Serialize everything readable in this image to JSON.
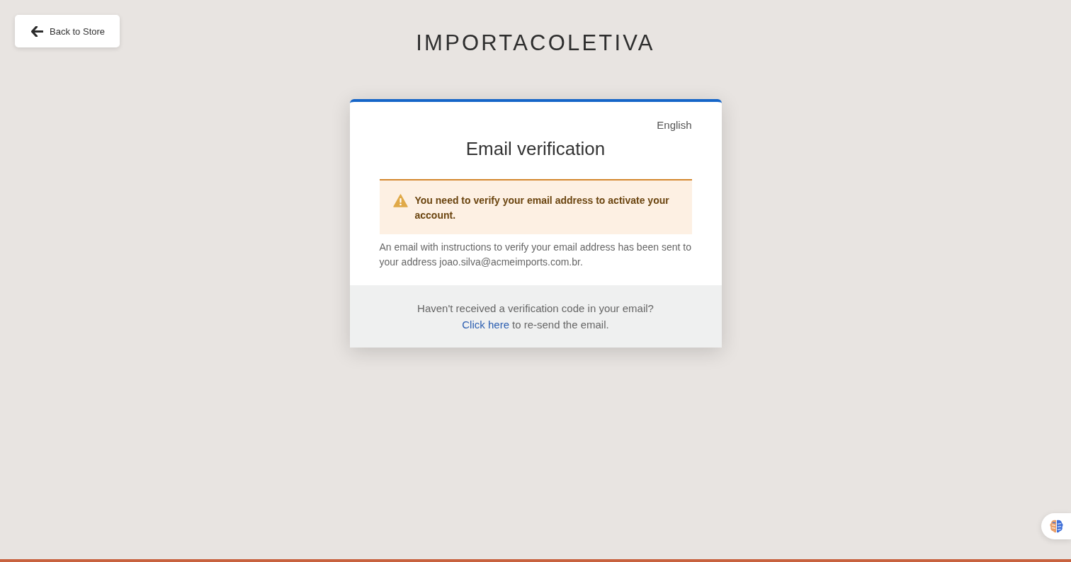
{
  "back_button": {
    "label": "Back to Store"
  },
  "brand": {
    "title": "IMPORTACOLETIVA"
  },
  "card": {
    "language": "English",
    "title": "Email verification",
    "alert": {
      "kind": "warning",
      "message": "You need to verify your email address to activate your account."
    },
    "instructions": "An email with instructions to verify your email address has been sent to your address joao.silva@acmeimports.com.br.",
    "footer": {
      "question": "Haven't received a verification code in your email?",
      "link": "Click here",
      "link_suffix": "to re-send the email."
    }
  }
}
